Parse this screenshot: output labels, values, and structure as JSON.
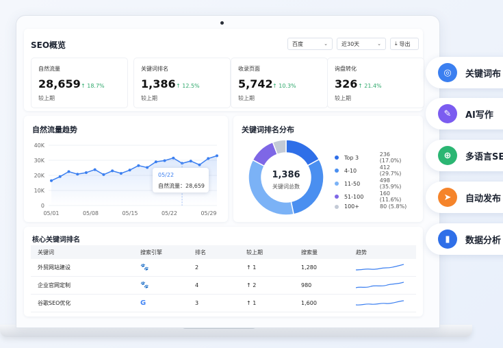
{
  "header": {
    "title": "SEO概览",
    "engine_select": "百度",
    "range_select": "近30天",
    "export_label": "导出"
  },
  "kpis": [
    {
      "label": "自然流量",
      "value": "28,659",
      "change": "↑ 18.7%",
      "compare": "较上期"
    },
    {
      "label": "关键词排名",
      "value": "1,386",
      "change": "↑ 12.5%",
      "compare": "较上期"
    },
    {
      "label": "收录页面",
      "value": "5,742",
      "change": "↑ 10.3%",
      "compare": "较上期"
    },
    {
      "label": "询盘转化",
      "value": "326",
      "change": "↑ 21.4%",
      "compare": "较上期"
    }
  ],
  "traffic": {
    "title": "自然流量趋势",
    "tooltip_date": "05/22",
    "tooltip_label": "自然流量：",
    "tooltip_value": "28,659"
  },
  "distribution": {
    "title": "关键词排名分布",
    "center_value": "1,386",
    "center_label": "关键词总数"
  },
  "chart_data": [
    {
      "type": "line",
      "title": "自然流量趋势",
      "x_ticks": [
        "05/01",
        "05/08",
        "05/15",
        "05/22",
        "05/29"
      ],
      "y_ticks": [
        "40K",
        "30K",
        "20K",
        "10K",
        "0"
      ],
      "ylim": [
        0,
        40000
      ],
      "values": [
        16500,
        19200,
        22500,
        20800,
        21800,
        23800,
        20500,
        23000,
        21300,
        23500,
        26500,
        25200,
        29000,
        29800,
        31500,
        28000,
        29500,
        27000,
        31200,
        33000
      ],
      "colors": {
        "line": "#3b7ff0"
      }
    },
    {
      "type": "pie",
      "title": "关键词排名分布",
      "slices": [
        {
          "label": "Top 3",
          "value": 236,
          "pct": "236 (17.0%)",
          "color": "#2f6fe8"
        },
        {
          "label": "4-10",
          "value": 412,
          "pct": "412 (29.7%)",
          "color": "#4a8ff0"
        },
        {
          "label": "11-50",
          "value": 498,
          "pct": "498 (35.9%)",
          "color": "#7bb2f6"
        },
        {
          "label": "51-100",
          "value": 160,
          "pct": "160 (11.6%)",
          "color": "#7e67e6"
        },
        {
          "label": "100+",
          "value": 80,
          "pct": "80 (5.8%)",
          "color": "#c3cad6"
        }
      ]
    }
  ],
  "keywords": {
    "title": "核心关键词排名",
    "headers": [
      "关键词",
      "搜索引擎",
      "排名",
      "较上期",
      "搜索量",
      "趋势"
    ],
    "rows": [
      {
        "keyword": "外贸网站建设",
        "engine": "baidu-icon",
        "rank": "2",
        "change": "↑ 1",
        "volume": "1,280"
      },
      {
        "keyword": "企业官网定制",
        "engine": "baidu-icon",
        "rank": "4",
        "change": "↑ 2",
        "volume": "980"
      },
      {
        "keyword": "谷歌SEO优化",
        "engine": "google-icon",
        "rank": "3",
        "change": "↑ 1",
        "volume": "1,600"
      }
    ]
  },
  "features": [
    {
      "label": "关键词布",
      "icon": "target-icon",
      "color": "#3b7ff0"
    },
    {
      "label": "AI写作",
      "icon": "pen-icon",
      "color": "#7b5cf0"
    },
    {
      "label": "多语言SE",
      "icon": "globe-icon",
      "color": "#2bb673"
    },
    {
      "label": "自动发布",
      "icon": "send-icon",
      "color": "#f5842b"
    },
    {
      "label": "数据分析",
      "icon": "bar-chart-icon",
      "color": "#2f6fe8"
    }
  ]
}
